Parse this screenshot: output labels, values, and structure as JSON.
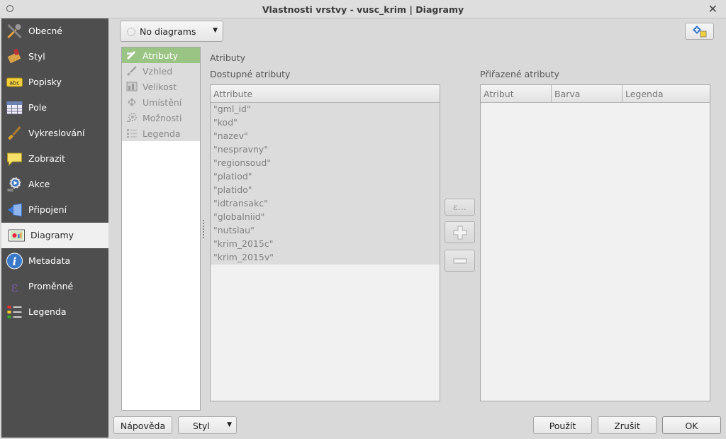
{
  "window": {
    "title": "Vlastnosti vrstvy - vusc_krim | Diagramy"
  },
  "sidebar": {
    "items": [
      {
        "label": "Obecné",
        "icon": "tools-icon"
      },
      {
        "label": "Styl",
        "icon": "paint-icon"
      },
      {
        "label": "Popisky",
        "icon": "abc-label-icon"
      },
      {
        "label": "Pole",
        "icon": "table-icon"
      },
      {
        "label": "Vykreslování",
        "icon": "brush-icon"
      },
      {
        "label": "Zobrazit",
        "icon": "speech-bubble-icon"
      },
      {
        "label": "Akce",
        "icon": "gear-play-icon"
      },
      {
        "label": "Připojení",
        "icon": "join-icon"
      },
      {
        "label": "Diagramy",
        "icon": "diagram-icon",
        "active": true
      },
      {
        "label": "Metadata",
        "icon": "info-icon"
      },
      {
        "label": "Proměnné",
        "icon": "epsilon-icon"
      },
      {
        "label": "Legenda",
        "icon": "legend-icon"
      }
    ]
  },
  "diagram_type": {
    "value": "No diagrams"
  },
  "subnav": {
    "items": [
      {
        "label": "Atributy",
        "icon": "attributes-icon",
        "active": true
      },
      {
        "label": "Vzhled",
        "icon": "brush-icon"
      },
      {
        "label": "Velikost",
        "icon": "size-icon"
      },
      {
        "label": "Umístění",
        "icon": "placement-icon"
      },
      {
        "label": "Možnosti",
        "icon": "options-icon"
      },
      {
        "label": "Legenda",
        "icon": "legend-icon"
      }
    ]
  },
  "attributes": {
    "section_title": "Atributy",
    "available_label": "Dostupné atributy",
    "assigned_label": "Přiřazené atributy",
    "available_header": "Attribute",
    "available": [
      "\"gml_id\"",
      "\"kod\"",
      "\"nazev\"",
      "\"nespravny\"",
      "\"regionsoud\"",
      "\"platiod\"",
      "\"platido\"",
      "\"idtransakc\"",
      "\"globalniid\"",
      "\"nutslau\"",
      "\"krim_2015c\"",
      "\"krim_2015v\""
    ],
    "assigned_headers": [
      "Atribut",
      "Barva",
      "Legenda"
    ],
    "expression_button": "ε…"
  },
  "buttons": {
    "help": "Nápověda",
    "style": "Styl",
    "apply": "Použít",
    "cancel": "Zrušit",
    "ok": "OK"
  },
  "colors": {
    "sidebar_bg": "#4e4e4e",
    "active_subnav": "#9ac483"
  }
}
